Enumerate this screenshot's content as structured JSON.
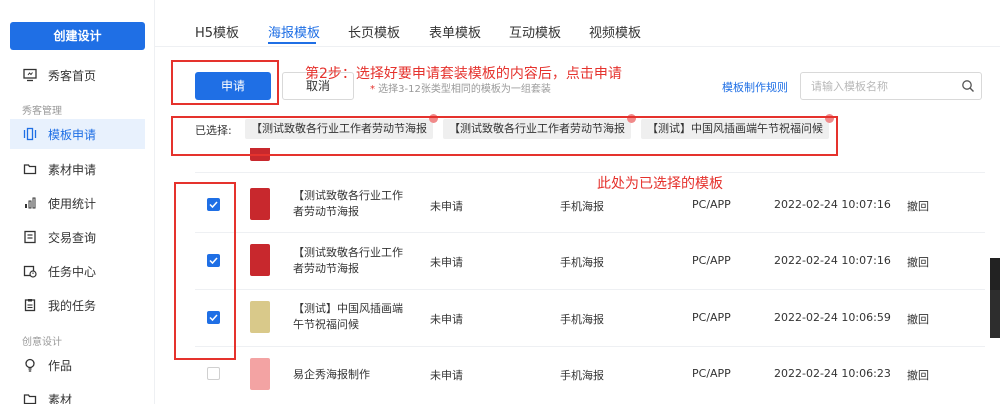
{
  "sidebar": {
    "create_button": "创建设计",
    "group_show": "秀客管理",
    "group_creative": "创意设计",
    "items": [
      {
        "label": "秀客首页",
        "icon": "monitor-icon"
      },
      {
        "label": "模板申请",
        "icon": "template-icon",
        "active": true
      },
      {
        "label": "素材申请",
        "icon": "folder-icon"
      },
      {
        "label": "使用统计",
        "icon": "bar-chart-icon"
      },
      {
        "label": "交易查询",
        "icon": "document-icon"
      },
      {
        "label": "任务中心",
        "icon": "calendar-clock-icon"
      },
      {
        "label": "我的任务",
        "icon": "clipboard-icon"
      },
      {
        "label": "作品",
        "icon": "lightbulb-icon"
      },
      {
        "label": "素材",
        "icon": "folder-icon"
      }
    ]
  },
  "tabs": [
    {
      "label": "H5模板"
    },
    {
      "label": "海报模板",
      "active": true
    },
    {
      "label": "长页模板"
    },
    {
      "label": "表单模板"
    },
    {
      "label": "互动模板"
    },
    {
      "label": "视频模板"
    }
  ],
  "toolbar": {
    "apply_label": "申请",
    "cancel_label": "取消",
    "hint_star": "*",
    "hint_text": " 选择3-12张类型相同的模板为一组套装",
    "rule_link": "模板制作规则",
    "search_placeholder": "请输入模板名称"
  },
  "selected": {
    "label": "已选择:",
    "chips": [
      "【测试致敬各行业工作者劳动节海报",
      "【测试致敬各行业工作者劳动节海报",
      "【测试】中国风插画端午节祝福问候"
    ]
  },
  "annotations": {
    "step2": "第2步：选择好要申请套装模板的内容后，点击申请",
    "selected_note": "此处为已选择的模板"
  },
  "table": {
    "rows": [
      {
        "checked": true,
        "name": "【测试致敬各行业工作者劳动节海报",
        "status": "未申请",
        "type": "手机海报",
        "platform": "PC/APP",
        "time": "2022-02-24 10:07:16",
        "action": "撤回",
        "thumb_color": "#c8282d"
      },
      {
        "checked": true,
        "name": "【测试致敬各行业工作者劳动节海报",
        "status": "未申请",
        "type": "手机海报",
        "platform": "PC/APP",
        "time": "2022-02-24 10:07:16",
        "action": "撤回",
        "thumb_color": "#c8282d"
      },
      {
        "checked": true,
        "name": "【测试】中国风插画端午节祝福问候",
        "status": "未申请",
        "type": "手机海报",
        "platform": "PC/APP",
        "time": "2022-02-24 10:06:59",
        "action": "撤回",
        "thumb_color": "#d9c98a"
      },
      {
        "checked": false,
        "name": "易企秀海报制作",
        "status": "未申请",
        "type": "手机海报",
        "platform": "PC/APP",
        "time": "2022-02-24 10:06:23",
        "action": "撤回",
        "thumb_color": "#f3a3a3"
      }
    ]
  },
  "colors": {
    "accent": "#1f6fe5",
    "annotation": "#e5322d"
  }
}
